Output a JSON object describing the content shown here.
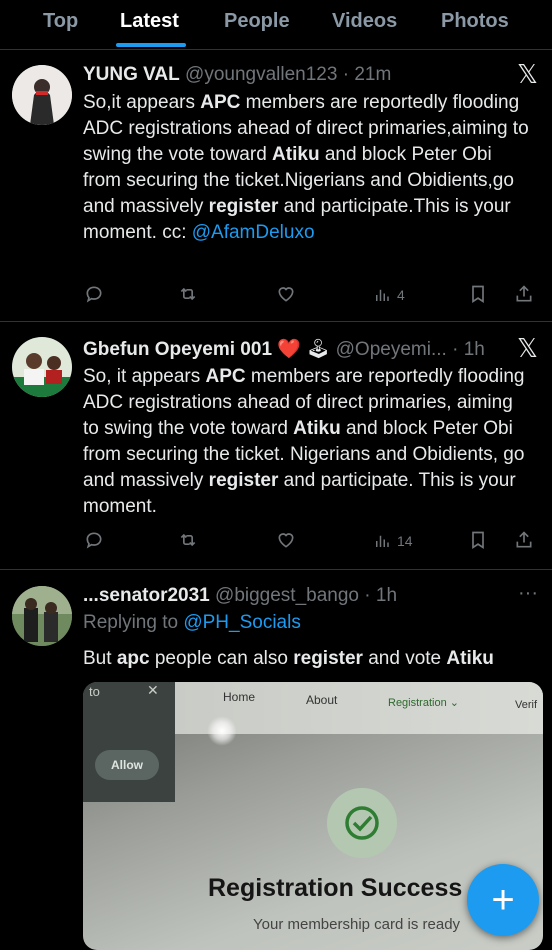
{
  "tabs": [
    "Top",
    "Latest",
    "People",
    "Videos",
    "Photos"
  ],
  "active_tab": "Latest",
  "tweets": [
    {
      "name": "YUNG VAL",
      "handle": "@youngvallen123",
      "time": "21m",
      "text_parts": [
        "So,it appears ",
        "APC",
        " members are reportedly flooding ADC registrations ahead of direct primaries,aiming to swing the vote toward ",
        "Atiku",
        " and block Peter Obi from securing the ticket.Nigerians and Obidients,go and massively ",
        "register",
        " and participate.This is your moment. cc: "
      ],
      "mention": "@AfamDeluxo",
      "views": "4"
    },
    {
      "name": "Gbefun Opeyemi 001",
      "name_emoji": "❤️ 🕹",
      "handle": "@Opeyemi...",
      "time": "1h",
      "text_parts": [
        "So, it appears ",
        "APC",
        " members are reportedly flooding ADC registrations ahead of direct primaries, aiming to swing the vote toward ",
        "Atiku",
        " and block Peter Obi from securing the ticket. Nigerians and Obidients, go and massively ",
        "register",
        " and participate. This is your moment."
      ],
      "views": "14"
    },
    {
      "name": "...senator2031",
      "handle": "@biggest_bango",
      "time": "1h",
      "replying_label": "Replying to",
      "replying_to": "@PH_Socials",
      "text_parts": [
        "But ",
        "apc",
        " people can also ",
        "register",
        " and vote ",
        "Atiku"
      ]
    }
  ],
  "photo": {
    "popup_text": "to",
    "popup_close": "✕",
    "allow": "Allow",
    "nav": [
      "Home",
      "About",
      "Registration ⌄",
      "Verif"
    ],
    "heading": "Registration Success",
    "sub": "Your membership card is ready"
  },
  "fab_label": "+",
  "more_label": "···",
  "x_logo": "𝕏"
}
